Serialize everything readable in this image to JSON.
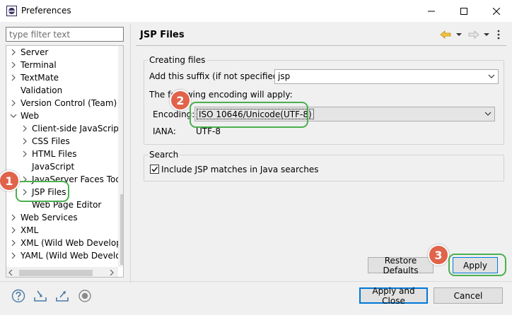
{
  "window": {
    "title": "Preferences"
  },
  "filter": {
    "placeholder": "type filter text"
  },
  "tree": {
    "items": [
      {
        "label": "Server",
        "expander": "collapsed"
      },
      {
        "label": "Terminal",
        "expander": "collapsed"
      },
      {
        "label": "TextMate",
        "expander": "collapsed"
      },
      {
        "label": "Validation",
        "expander": "none"
      },
      {
        "label": "Version Control (Team)",
        "expander": "collapsed"
      },
      {
        "label": "Web",
        "expander": "expanded"
      },
      {
        "label": "Client-side JavaScript",
        "expander": "collapsed"
      },
      {
        "label": "CSS Files",
        "expander": "collapsed"
      },
      {
        "label": "HTML Files",
        "expander": "collapsed"
      },
      {
        "label": "JavaScript",
        "expander": "none"
      },
      {
        "label": "JavaServer Faces Tools",
        "expander": "collapsed"
      },
      {
        "label": "JSP Files",
        "expander": "collapsed"
      },
      {
        "label": "Web Page Editor",
        "expander": "none"
      },
      {
        "label": "Web Services",
        "expander": "collapsed"
      },
      {
        "label": "XML",
        "expander": "collapsed"
      },
      {
        "label": "XML (Wild Web Developer)",
        "expander": "collapsed"
      },
      {
        "label": "YAML (Wild Web Developer)",
        "expander": "collapsed"
      }
    ]
  },
  "page": {
    "title": "JSP Files"
  },
  "creating_files": {
    "legend": "Creating files",
    "suffix_label": "Add this suffix (if not specified):",
    "suffix_value": "jsp",
    "encoding_note": "The following encoding will apply:",
    "encoding_label": "Encoding:",
    "encoding_value": "ISO 10646/Unicode(UTF-8)",
    "iana_label": "IANA:",
    "iana_value": "UTF-8"
  },
  "search": {
    "legend": "Search",
    "checkbox_label": "Include JSP matches in Java searches",
    "checked": true
  },
  "buttons": {
    "restore": "Restore Defaults",
    "apply": "Apply",
    "apply_close": "Apply and Close",
    "cancel": "Cancel"
  },
  "annotations": [
    "1",
    "2",
    "3"
  ],
  "colors": {
    "highlight": "#4bb04f",
    "badge": "#e0634a",
    "focus": "#0078d7"
  }
}
